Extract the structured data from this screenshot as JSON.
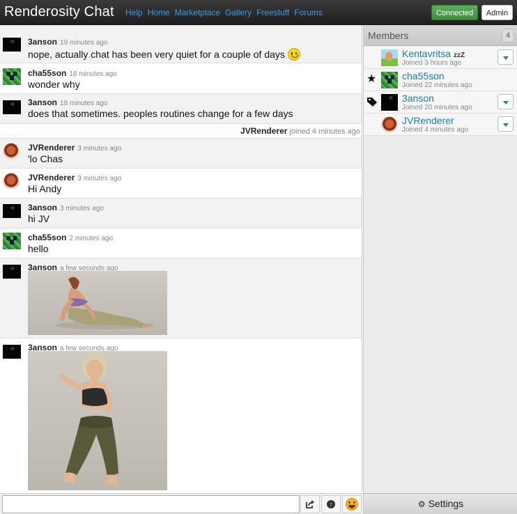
{
  "app": {
    "title": "Renderosity Chat"
  },
  "nav": [
    "Help",
    "Home",
    "Marketplace",
    "Gallery",
    "Freestuff",
    "Forums"
  ],
  "status": {
    "connected": "Connected",
    "admin": "Admin"
  },
  "messages": [
    {
      "nick": "3anson",
      "time": "19 minutes ago",
      "text": "nope, actually chat has been very quiet for a couple of days",
      "avatar": "black-avatar",
      "smiley": true
    },
    {
      "nick": "cha55son",
      "time": "18 minutes ago",
      "text": "wonder why",
      "avatar": "creeper-avatar"
    },
    {
      "nick": "3anson",
      "time": "18 minutes ago",
      "text": "does that sometimes. peoples routines change for a few days",
      "avatar": "black-avatar"
    },
    {
      "nick": "JVRenderer",
      "time": "3 minutes ago",
      "text": "'lo Chas",
      "avatar": "poser-avatar"
    },
    {
      "nick": "JVRenderer",
      "time": "3 minutes ago",
      "text": "Hi Andy",
      "avatar": "poser-avatar"
    },
    {
      "nick": "3anson",
      "time": "3 minutes ago",
      "text": "hi JV",
      "avatar": "black-avatar"
    },
    {
      "nick": "cha55son",
      "time": "2 minutes ago",
      "text": "hello",
      "avatar": "creeper-avatar"
    },
    {
      "nick": "3anson",
      "time": "a few seconds ago",
      "image": "reclining-figure-render",
      "avatar": "black-avatar"
    },
    {
      "nick": "3anson",
      "time": "a few seconds ago",
      "image": "standing-figure-render",
      "avatar": "black-avatar"
    }
  ],
  "join_notice": {
    "nick": "JVRenderer",
    "text": "joined 4 minutes ago"
  },
  "members": {
    "title": "Members",
    "count": "4",
    "list": [
      {
        "name": "Kentavritsa",
        "status": "zzZ",
        "joined": "Joined 3 hours ago",
        "icon": "",
        "avatar": "landscape-avatar"
      },
      {
        "name": "cha55son",
        "status": "",
        "joined": "Joined 22 minutes ago",
        "icon": "star-icon",
        "avatar": "creeper-avatar"
      },
      {
        "name": "3anson",
        "status": "",
        "joined": "Joined 20 minutes ago",
        "icon": "tag-icon",
        "avatar": "black-avatar"
      },
      {
        "name": "JVRenderer",
        "status": "",
        "joined": "Joined 4 minutes ago",
        "icon": "",
        "avatar": "poser-avatar"
      }
    ]
  },
  "input": {
    "value": "",
    "placeholder": ""
  },
  "toolbar": {
    "share": "share-icon",
    "upload": "upload-icon",
    "emoji": "emoji-icon",
    "settings_label": "Settings"
  },
  "colors": {
    "link": "#3b9be0",
    "member_name": "#1f7ac0",
    "connected": "#4f9f4f",
    "topbar": "#2a2a2a"
  }
}
